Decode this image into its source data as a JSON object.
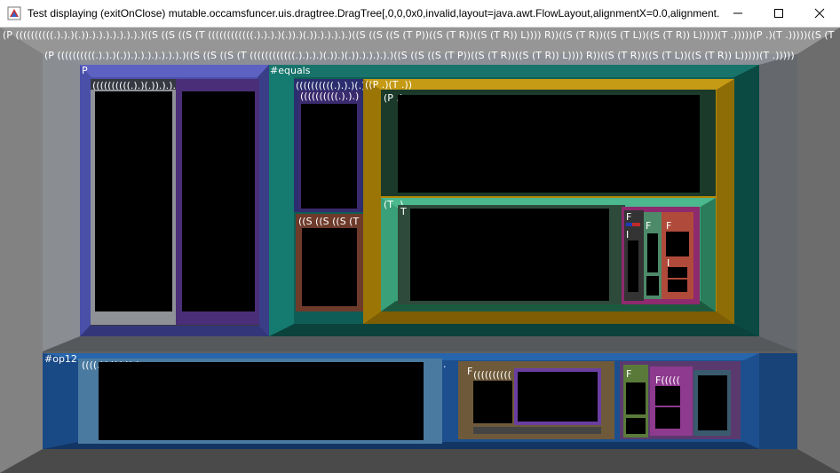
{
  "window": {
    "title": "Test displaying (exitOnClose) mutable.occamsfuncer.uis.dragtree.DragTree[,0,0,0x0,invalid,layout=java.awt.FlowLayout,alignmentX=0.0,alignment...",
    "minimize_icon": "minimize-icon",
    "maximize_icon": "maximize-icon",
    "close_icon": "close-icon"
  },
  "tree": {
    "top_row_1": "(P ((((((((((.).).)(.)).).).).).).).).)((S ((S ((S (T ((((((((((((.).).).)(.)).)(.)).).).).).)((S ((S ((S (T P))((S (T R))((S (T R)) L)))) R))((S (T R))((S (T L))((S (T R)) L)))))(T .)))))(P .)(T .)))))((S (T A)",
    "top_row_2": "(P ((((((((((.).).)(.)).).).).).).).).)((S ((S ((S (T ((((((((((((.).).).)(.)).)(.)).).).).).)((S ((S ((S (T P))((S (T R))((S (T R)) L)))) R))((S (T R))((S (T L))((S (T R)) L)))))(T .)))))(P",
    "p_node": "P",
    "p_child": "((((((((((.).)(.)).).).).).",
    "equals_node": "#equals",
    "eq_child_a": "((((((((((.).).)(.)(.",
    "eq_child_a_inner": "((((((((((.).).)",
    "eq_child_b": "((S ((S ((S (T",
    "pt_node": "((P .)(T .))",
    "p_dot": "(P .)",
    "t_dot": "(T .)",
    "t_letter": "T",
    "f1": "F",
    "f2": "F",
    "f3": "F",
    "i1": "I",
    "i2": "I",
    "op12_node": "#op12",
    "op12_child": "((((.)(.))(.)).)",
    "dot_mark": ".",
    "r1": "F",
    "r1_child": "((((((((((",
    "r2": "F",
    "r2_child": "((((((",
    "r3": "F((((("
  }
}
